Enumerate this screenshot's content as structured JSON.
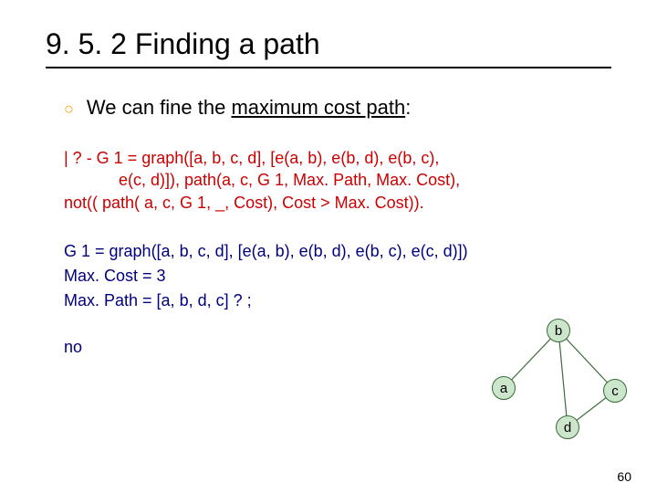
{
  "title": "9. 5. 2 Finding a path",
  "bullet": {
    "prefix": "We can fine the ",
    "underlined": "maximum cost path",
    "suffix": ":"
  },
  "code": {
    "l1": "| ? - G 1 = graph([a, b, c, d], [e(a, b), e(b, d), e(b, c),",
    "l2": "e(c, d)]), path(a, c, G 1, Max. Path, Max. Cost),",
    "l3": "not(( path( a, c, G 1, _, Cost), Cost > Max. Cost))."
  },
  "output": {
    "l1": "G 1 = graph([a, b, c, d], [e(a, b), e(b, d), e(b, c), e(c, d)])",
    "l2": "Max. Cost = 3",
    "l3": "Max. Path = [a, b, d, c] ? ;",
    "l4": "no"
  },
  "graph": {
    "nodes": {
      "a": "a",
      "b": "b",
      "c": "c",
      "d": "d"
    }
  },
  "page_number": "60"
}
